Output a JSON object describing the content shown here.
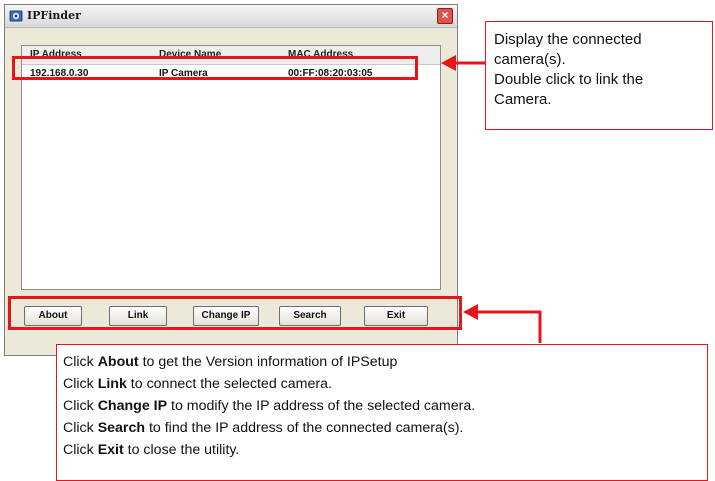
{
  "window": {
    "title": "IPFinder",
    "close_glyph": "×"
  },
  "device_list": {
    "columns": [
      "IP Address",
      "Device Name",
      "MAC Address"
    ],
    "rows": [
      {
        "ip": "192.168.0.30",
        "name": "IP Camera",
        "mac": "00:FF:08:20:03:05"
      }
    ]
  },
  "buttons": {
    "about": "About",
    "link": "Link",
    "change_ip": "Change IP",
    "search": "Search",
    "exit": "Exit"
  },
  "annotations": {
    "list": {
      "line1": "Display the connected",
      "line2": "camera(s).",
      "line3": "Double click to link the",
      "line4": "Camera."
    },
    "buttons": [
      {
        "pre": "Click ",
        "key": "About",
        "post": " to get the Version information of IPSetup"
      },
      {
        "pre": "Click ",
        "key": "Link",
        "post": " to connect the selected camera."
      },
      {
        "pre": "Click ",
        "key": "Change IP",
        "post": " to modify the IP address of the selected camera."
      },
      {
        "pre": "Click ",
        "key": "Search",
        "post": " to find the IP address of the connected camera(s)."
      },
      {
        "pre": "Click ",
        "key": "Exit",
        "post": " to close the utility."
      }
    ]
  },
  "colors": {
    "annotation_red": "#e8141c",
    "window_bg": "#ece9d8"
  },
  "icons": {
    "app": "app-icon",
    "close": "close-icon"
  }
}
